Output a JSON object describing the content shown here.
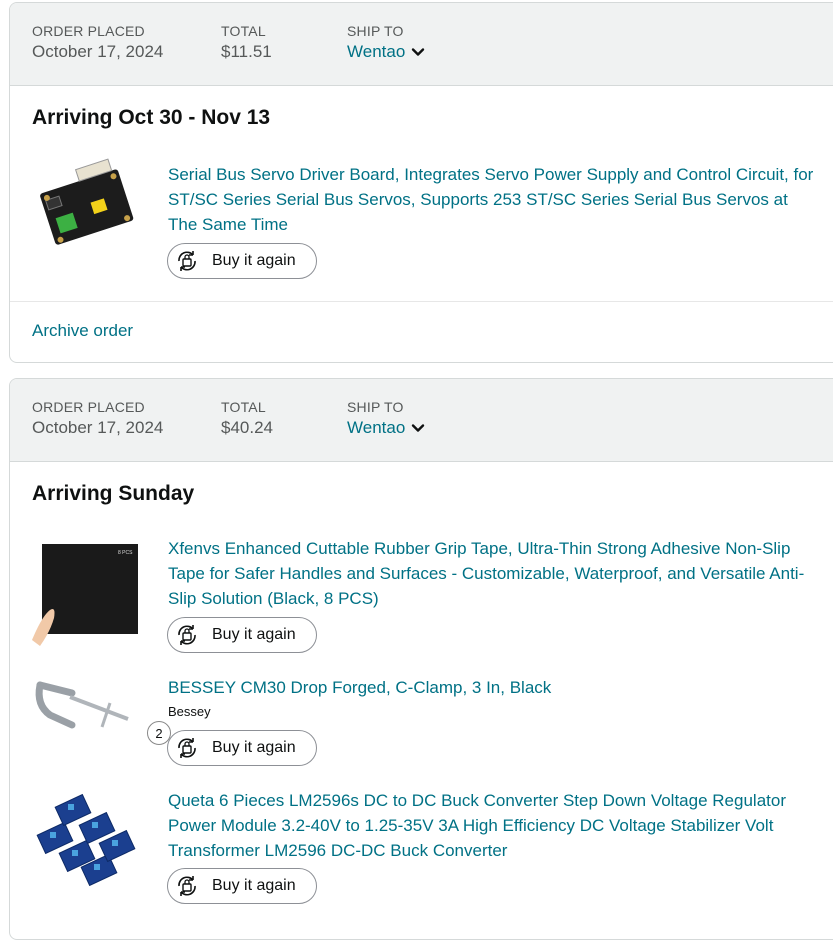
{
  "orders": [
    {
      "header": {
        "order_placed_label": "ORDER PLACED",
        "order_placed_date": "October 17, 2024",
        "total_label": "TOTAL",
        "total_value": "$11.51",
        "ship_to_label": "SHIP TO",
        "ship_to_name": "Wentao"
      },
      "arriving": "Arriving Oct 30 - Nov 13",
      "items": [
        {
          "title": "Serial Bus Servo Driver Board, Integrates Servo Power Supply and Control Circuit, for ST/SC Series Serial Bus Servos, Supports 253 ST/SC Series Serial Bus Servos at The Same Time",
          "buy_again_label": "Buy it again",
          "thumb_icon": "servo-driver-board"
        }
      ],
      "archive_label": "Archive order"
    },
    {
      "header": {
        "order_placed_label": "ORDER PLACED",
        "order_placed_date": "October 17, 2024",
        "total_label": "TOTAL",
        "total_value": "$40.24",
        "ship_to_label": "SHIP TO",
        "ship_to_name": "Wentao"
      },
      "arriving": "Arriving Sunday",
      "items": [
        {
          "title": "Xfenvs Enhanced Cuttable Rubber Grip Tape, Ultra-Thin Strong Adhesive Non-Slip Tape for Safer Handles and Surfaces - Customizable, Waterproof, and Versatile Anti-Slip Solution (Black, 8 PCS)",
          "buy_again_label": "Buy it again",
          "thumb_icon": "grip-tape-sheet",
          "thumb_label": "8 PCS"
        },
        {
          "title": "BESSEY CM30 Drop Forged, C-Clamp, 3 In, Black",
          "brand": "Bessey",
          "quantity": "2",
          "buy_again_label": "Buy it again",
          "thumb_icon": "c-clamp"
        },
        {
          "title": "Queta 6 Pieces LM2596s DC to DC Buck Converter Step Down Voltage Regulator Power Module 3.2-40V to 1.25-35V 3A High Efficiency DC Voltage Stabilizer Volt Transformer LM2596 DC-DC Buck Converter",
          "buy_again_label": "Buy it again",
          "thumb_icon": "buck-converter-modules"
        }
      ]
    }
  ],
  "colors": {
    "link": "#007185",
    "header_bg": "#f0f2f2",
    "border": "#d5d9d9"
  }
}
